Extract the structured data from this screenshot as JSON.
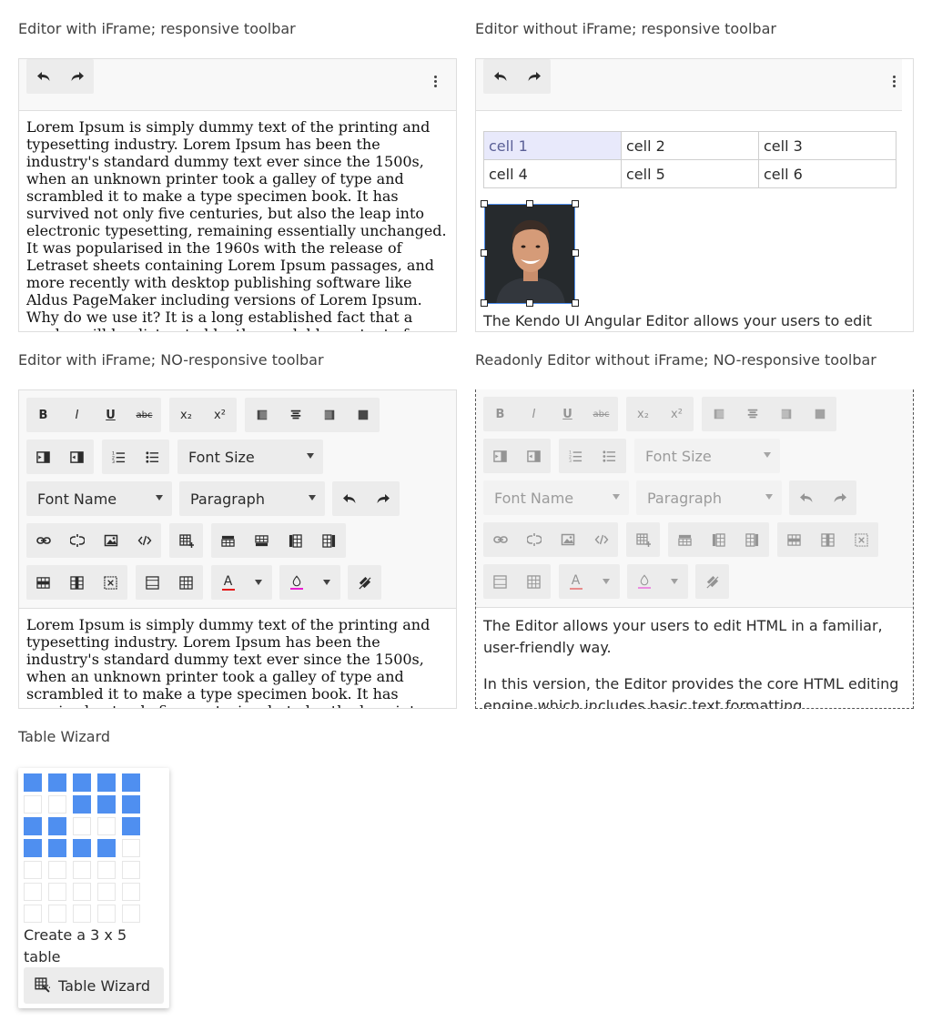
{
  "sections": {
    "iframe_responsive": "Editor with iFrame; responsive toolbar",
    "no_iframe_responsive": "Editor without iFrame; responsive toolbar",
    "iframe_no_responsive": "Editor with iFrame; NO-responsive toolbar",
    "readonly_no_iframe": "Readonly Editor without iFrame; NO-responsive toolbar",
    "table_wizard": "Table Wizard"
  },
  "lorem_text": "Lorem Ipsum is simply dummy text of the printing and typesetting industry. Lorem Ipsum has been the industry's standard dummy text ever since the 1500s, when an unknown printer took a galley of type and scrambled it to make a type specimen book. It has survived not only five centuries, but also the leap into electronic typesetting, remaining essentially unchanged. It was popularised in the 1960s with the release of Letraset sheets containing Lorem Ipsum passages, and more recently with desktop publishing software like Aldus PageMaker including versions of Lorem Ipsum. Why do we use it? It is a long established fact that a reader will be distracted by the readable content of a page when looking at its layout.",
  "table_cells": [
    [
      "cell 1",
      "cell 2",
      "cell 3"
    ],
    [
      "cell 4",
      "cell 5",
      "cell 6"
    ]
  ],
  "editor2_text": "The Kendo UI Angular Editor allows your users to edit",
  "dropdowns": {
    "font_size": "Font Size",
    "font_name": "Font Name",
    "paragraph": "Paragraph"
  },
  "toolbar_glyphs": {
    "bold": "B",
    "italic": "I",
    "underline": "U",
    "strike": "abc",
    "subscript": "x₂",
    "superscript": "x²",
    "font_color": "A"
  },
  "readonly_text": {
    "p1": "The Editor allows your users to edit HTML in a familiar, user-friendly way.",
    "p2": "In this version, the Editor provides the core HTML editing engine which includes basic text formatting"
  },
  "wizard": {
    "status": "Create a 3 x 5 table",
    "button_label": "Table Wizard",
    "grid": [
      [
        1,
        1,
        1,
        1,
        1
      ],
      [
        0,
        0,
        1,
        1,
        1
      ],
      [
        1,
        1,
        0,
        0,
        1
      ],
      [
        1,
        1,
        1,
        1,
        0
      ],
      [
        0,
        0,
        0,
        0,
        0
      ],
      [
        0,
        0,
        0,
        0,
        0
      ],
      [
        0,
        0,
        0,
        0,
        0
      ]
    ]
  },
  "colors": {
    "accent": "#4f8ff0",
    "font_color_bar": "#e51a1a",
    "background_color_bar": "#e81ed1",
    "selection": "#e8e9fb"
  },
  "icons": [
    "undo-icon",
    "redo-icon",
    "more-vertical-icon",
    "bold-icon",
    "italic-icon",
    "underline-icon",
    "strikethrough-icon",
    "subscript-icon",
    "superscript-icon",
    "align-left-icon",
    "align-center-icon",
    "align-right-icon",
    "align-justify-icon",
    "indent-icon",
    "outdent-icon",
    "ordered-list-icon",
    "unordered-list-icon",
    "link-icon",
    "unlink-icon",
    "image-icon",
    "view-source-icon",
    "insert-table-icon",
    "add-row-above-icon",
    "add-row-below-icon",
    "add-column-before-icon",
    "add-column-after-icon",
    "delete-row-icon",
    "delete-column-icon",
    "delete-table-icon",
    "merge-cells-icon",
    "split-cell-icon",
    "font-color-icon",
    "background-color-icon",
    "clear-format-icon",
    "table-wizard-icon"
  ]
}
